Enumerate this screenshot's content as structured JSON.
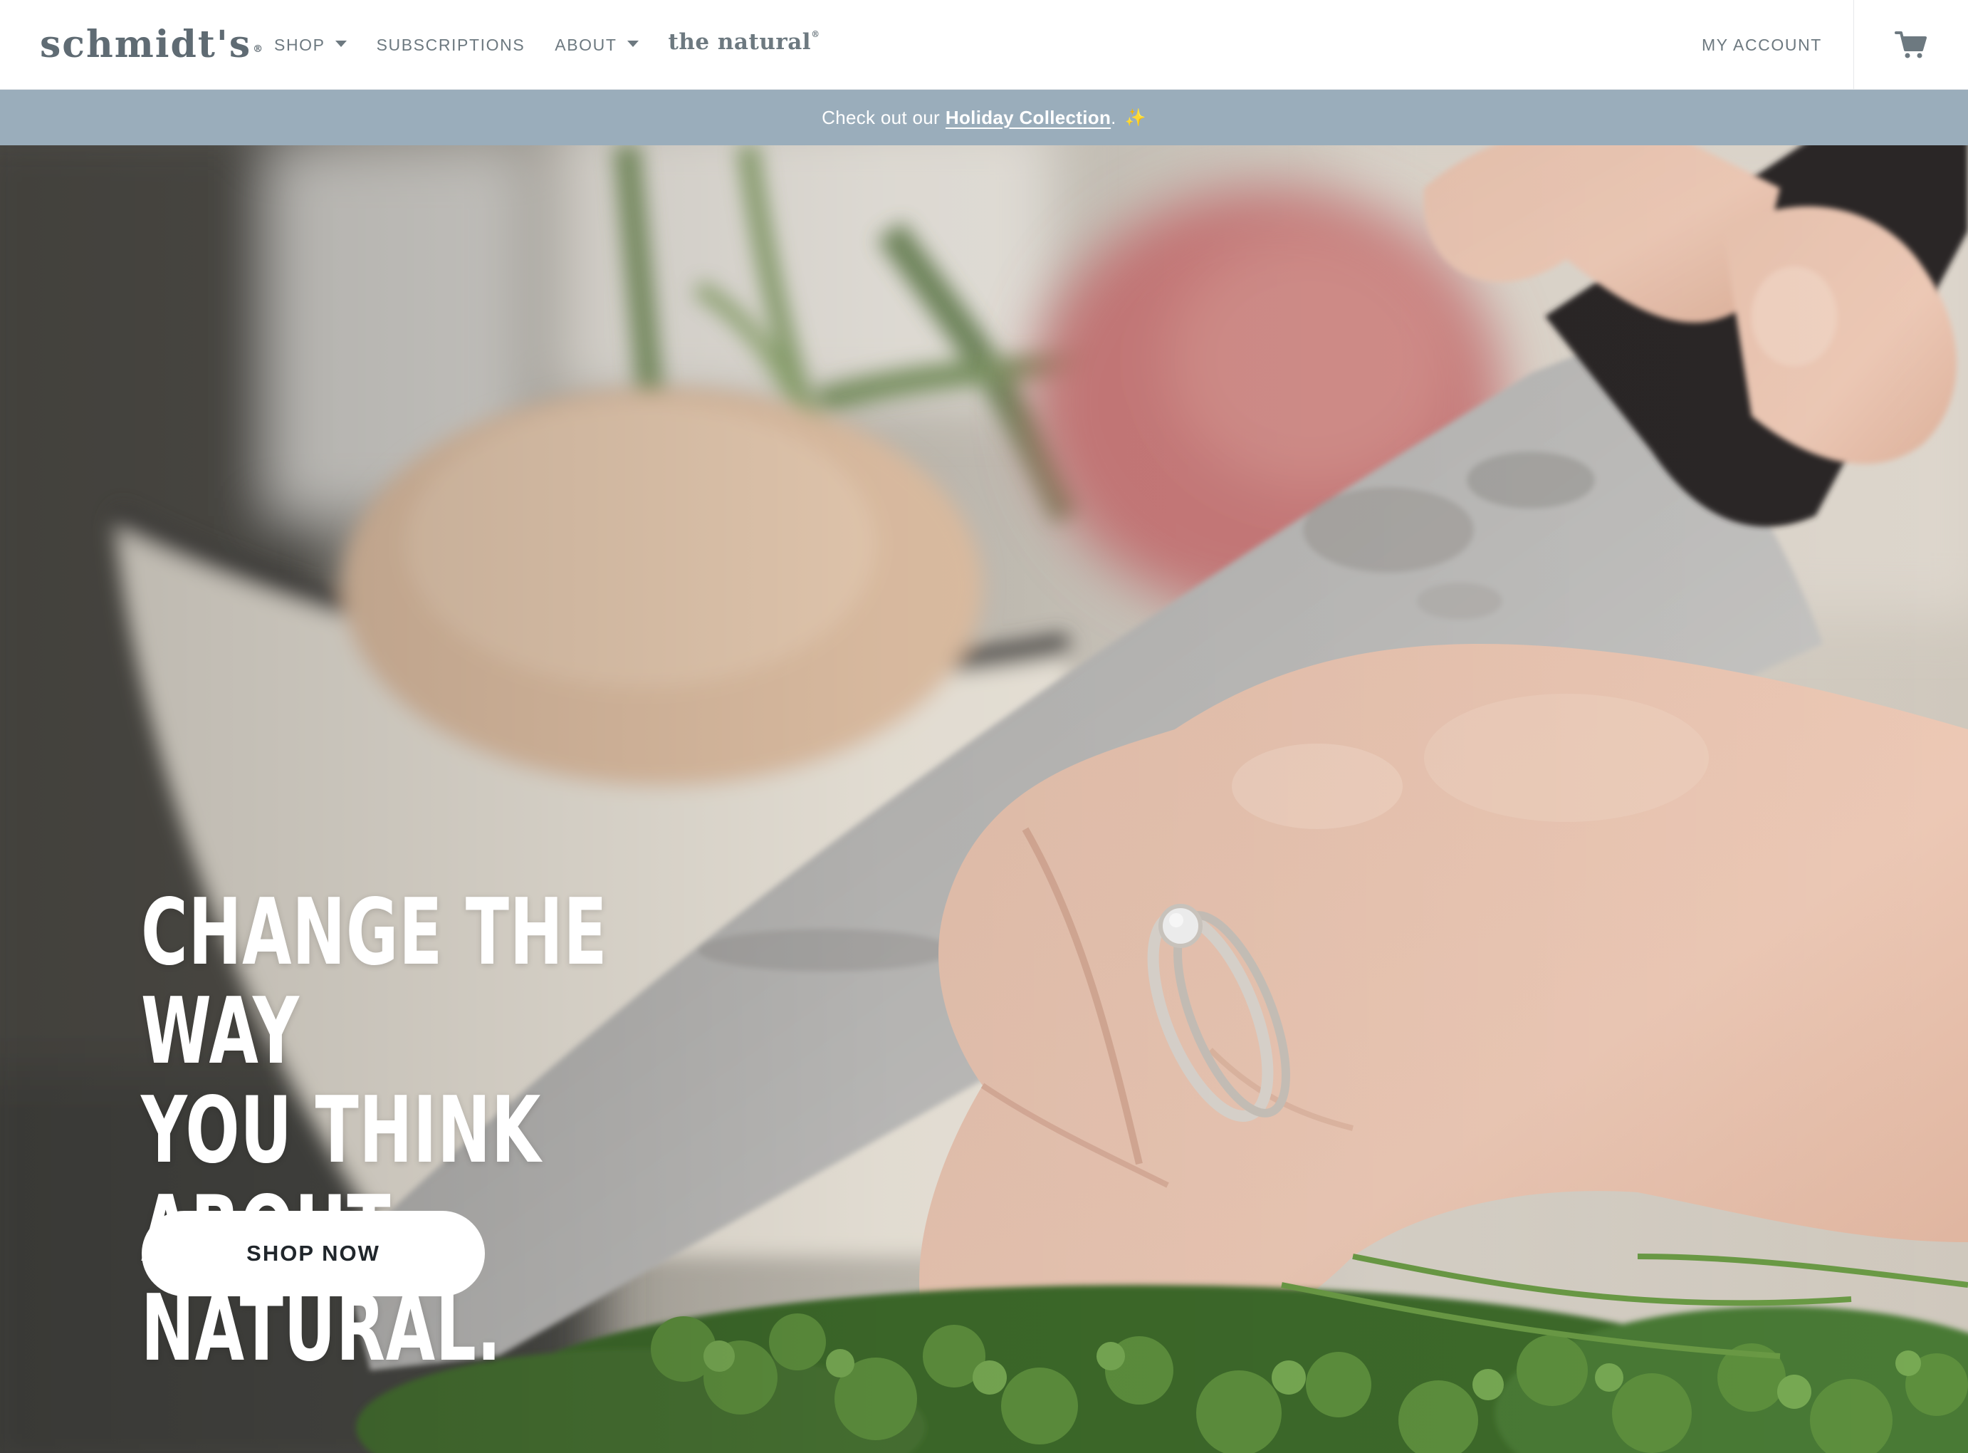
{
  "header": {
    "logo_text": "schmidt's",
    "logo_mark": "®",
    "nav": {
      "shop_label": "SHOP",
      "subscriptions_label": "SUBSCRIPTIONS",
      "about_label": "ABOUT",
      "brand_link_label": "the natural",
      "brand_link_mark": "®"
    },
    "my_account_label": "MY ACCOUNT",
    "cart_icon": "cart-icon"
  },
  "promo": {
    "prefix": "Check out our",
    "link_label": "Holiday Collection",
    "suffix": ".",
    "emoji": "✨"
  },
  "hero": {
    "title_line1": "CHANGE THE WAY",
    "title_line2": "YOU THINK ABOUT",
    "title_line3": "NATURAL.",
    "cta_label": "SHOP NOW"
  },
  "colors": {
    "promo_bar": "#9aadbb",
    "nav_text": "#6d7980",
    "logo": "#5f6b73",
    "cta_text": "#20262b"
  }
}
